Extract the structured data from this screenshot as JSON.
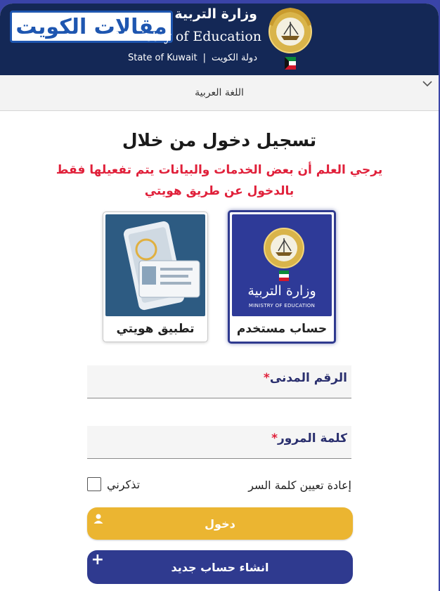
{
  "header": {
    "watermark": "مقالات الكويت",
    "ministry_ar": "وزارة التربية",
    "ministry_en": "Ministry of Education",
    "state_en": "State of Kuwait",
    "separator": "|",
    "state_ar": "دولة الكويت"
  },
  "language": {
    "label": "اللغة العربية"
  },
  "login": {
    "title": "تسجيل دخول من خلال",
    "notice": "يرجي العلم أن بعض الخدمات والبيانات يتم تفعيلها فقط بالدخول عن طريق هويتي"
  },
  "options": {
    "user_account": {
      "label": "حساب مستخدم",
      "logo_ar": "وزارة التربية",
      "logo_en": "MINISTRY OF EDUCATION"
    },
    "hawyti_app": {
      "label": "تطبيق هويتي"
    }
  },
  "form": {
    "civil_id_label": "الرقم المدنى",
    "password_label": "كلمة المرور",
    "required_mark": "*",
    "forgot_password": "إعادة تعيين كلمة السر",
    "remember_me": "تذكرني"
  },
  "buttons": {
    "login": "دخول",
    "create_account": "انشاء حساب جديد",
    "plus": "+"
  },
  "colors": {
    "header_bg": "#142856",
    "accent_blue": "#2f3a8f",
    "login_yellow": "#ebb531",
    "notice_red": "#e0203a"
  }
}
